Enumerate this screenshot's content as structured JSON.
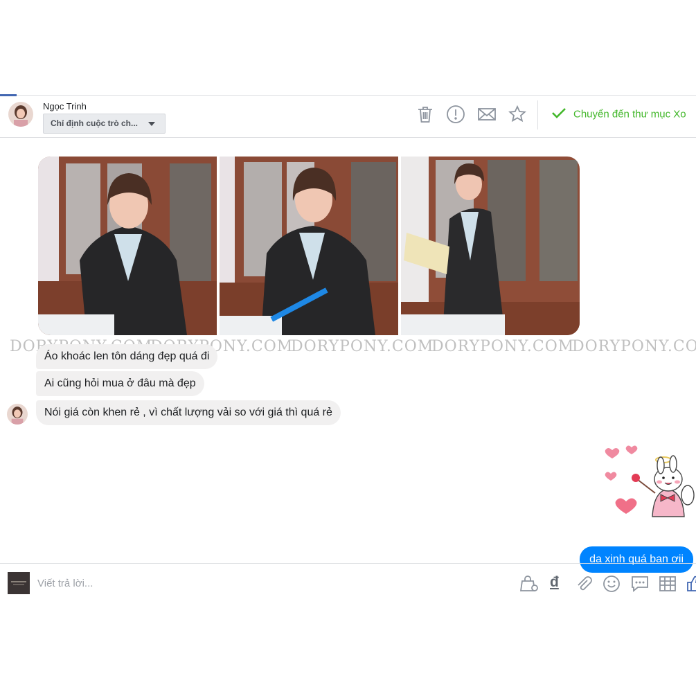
{
  "header": {
    "contact_name": "Ngọc Trinh",
    "assign_label": "Chỉ định cuộc trò ch...",
    "move_to_done_label": "Chuyển đến thư mục Xo",
    "icons": [
      "trash-icon",
      "alert-icon",
      "mail-icon",
      "star-icon",
      "check-icon"
    ]
  },
  "watermark": [
    "DORYPONY.COM",
    "DORYPONY.COM",
    "DORYPONY.COM",
    "DORYPONY.COM",
    "DORYPONY.COM"
  ],
  "messages": {
    "incoming": [
      "Áo khoác len tôn dáng đẹp quá đi",
      "Ai cũng hỏi mua ở đâu mà đẹp",
      "Nói giá còn khen rẻ , vì chất lượng vải so với giá thì quá rẻ"
    ],
    "outgoing": [
      "da xinh quá ban ơii"
    ]
  },
  "composer": {
    "placeholder": "Viết trả lời...",
    "currency_symbol": "đ",
    "icons": [
      "shopping-bag-icon",
      "currency-icon",
      "attachment-icon",
      "emoji-icon",
      "saved-reply-icon",
      "table-icon",
      "like-icon"
    ]
  },
  "colors": {
    "accent": "#4267b2",
    "outgoing_bubble": "#0084ff",
    "incoming_bubble": "#f1f0f0",
    "success": "#42b72a"
  }
}
